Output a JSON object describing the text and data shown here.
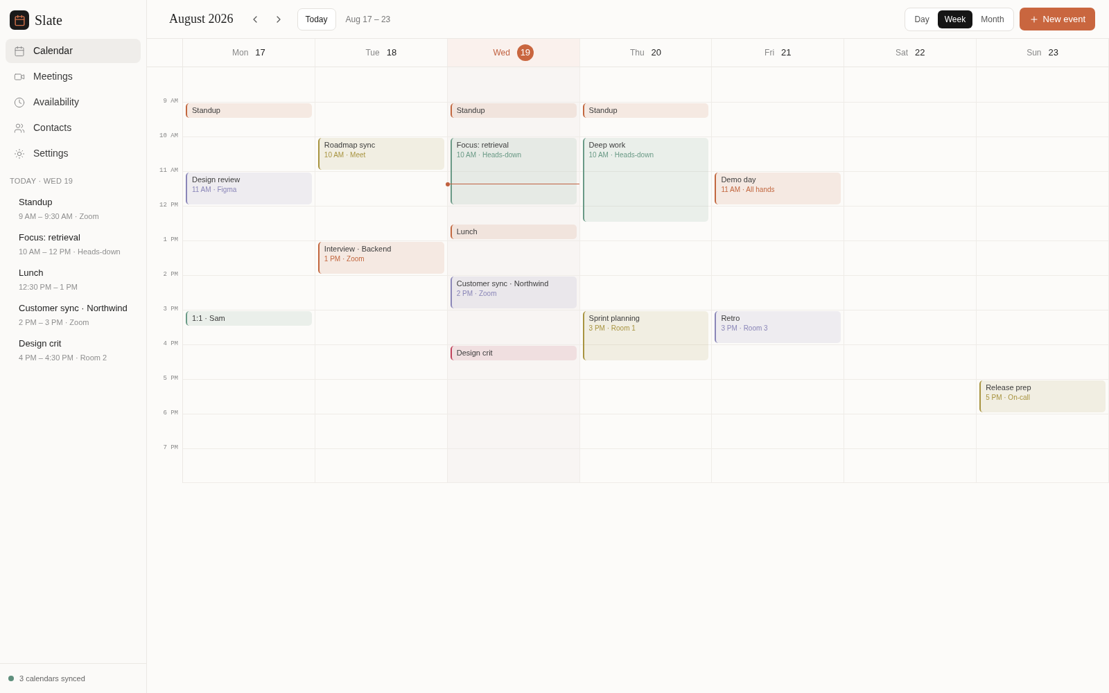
{
  "app": {
    "name": "Slate"
  },
  "nav": [
    {
      "label": "Calendar",
      "selected": true
    },
    {
      "label": "Meetings",
      "selected": false
    },
    {
      "label": "Availability",
      "selected": false
    },
    {
      "label": "Contacts",
      "selected": false
    },
    {
      "label": "Settings",
      "selected": false
    }
  ],
  "agenda": {
    "heading": "TODAY · WED 19",
    "items": [
      {
        "title": "Standup",
        "detail": "9 AM – 9:30 AM · Zoom"
      },
      {
        "title": "Focus: retrieval",
        "detail": "10 AM – 12 PM · Heads-down"
      },
      {
        "title": "Lunch",
        "detail": "12:30 PM – 1 PM"
      },
      {
        "title": "Customer sync · Northwind",
        "detail": "2 PM – 3 PM · Zoom"
      },
      {
        "title": "Design crit",
        "detail": "4 PM – 4:30 PM · Room 2"
      }
    ]
  },
  "sync_status": {
    "text": "3 calendars synced",
    "color": "#5e8f7c"
  },
  "header": {
    "title": "August 2026",
    "today_button": "Today",
    "range": "Aug 17 – 23",
    "views": [
      {
        "label": "Day",
        "selected": false
      },
      {
        "label": "Week",
        "selected": true
      },
      {
        "label": "Month",
        "selected": false
      }
    ],
    "new_event_button": "New event"
  },
  "hours": [
    "9 AM",
    "10 AM",
    "11 AM",
    "12 PM",
    "1 PM",
    "2 PM",
    "3 PM",
    "4 PM",
    "5 PM",
    "6 PM",
    "7 PM"
  ],
  "days": [
    {
      "weekday": "Mon",
      "date": "17",
      "selected": false,
      "events": [
        {
          "title": "Standup",
          "color": "#c2673f"
        },
        {
          "title": "Design review",
          "detail": "11 AM · Figma",
          "color": "#8a86b8"
        },
        {
          "title": "1:1 · Sam",
          "color": "#6a9a86"
        }
      ]
    },
    {
      "weekday": "Tue",
      "date": "18",
      "selected": false,
      "events": [
        {
          "title": "Roadmap sync",
          "detail": "10 AM · Meet",
          "color": "#a89440"
        },
        {
          "title": "Interview · Backend",
          "detail": "1 PM · Zoom",
          "color": "#c2673f"
        }
      ]
    },
    {
      "weekday": "Wed",
      "date": "19",
      "selected": true,
      "events": [
        {
          "title": "Standup",
          "color": "#c2673f"
        },
        {
          "title": "Focus: retrieval",
          "detail": "10 AM · Heads-down",
          "color": "#6a9a86"
        },
        {
          "title": "Lunch",
          "color": "#c2673f"
        },
        {
          "title": "Customer sync · Northwind",
          "detail": "2 PM · Zoom",
          "color": "#8a86b8"
        },
        {
          "title": "Design crit",
          "color": "#c0405a"
        }
      ]
    },
    {
      "weekday": "Thu",
      "date": "20",
      "selected": false,
      "events": [
        {
          "title": "Standup",
          "color": "#c2673f"
        },
        {
          "title": "Deep work",
          "detail": "10 AM · Heads-down",
          "color": "#6a9a86"
        },
        {
          "title": "Sprint planning",
          "detail": "3 PM · Room 1",
          "color": "#a89440"
        }
      ]
    },
    {
      "weekday": "Fri",
      "date": "21",
      "selected": false,
      "events": [
        {
          "title": "Demo day",
          "detail": "11 AM · All hands",
          "color": "#c2673f"
        },
        {
          "title": "Retro",
          "detail": "3 PM · Room 3",
          "color": "#8a86b8"
        }
      ]
    },
    {
      "weekday": "Sat",
      "date": "22",
      "selected": false
    },
    {
      "weekday": "Sun",
      "date": "23",
      "selected": false,
      "events": [
        {
          "title": "Release prep",
          "detail": "5 PM · On-call",
          "color": "#a89440"
        }
      ]
    }
  ]
}
